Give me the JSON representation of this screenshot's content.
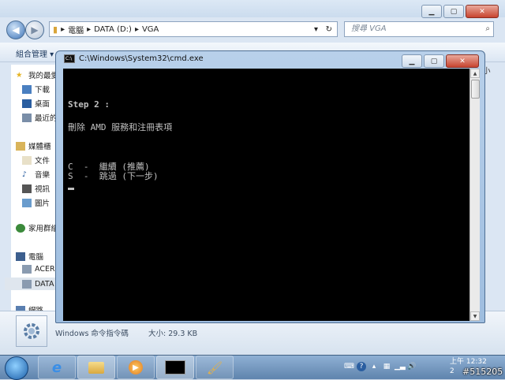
{
  "explorer": {
    "address": {
      "segments": [
        "電腦",
        "DATA (D:)",
        "VGA"
      ]
    },
    "search_placeholder": "搜尋 VGA",
    "organize_label": "組合管理 ▾",
    "sidebar": {
      "items": [
        {
          "label": "我的最愛",
          "icon": "star-icon"
        },
        {
          "label": "下載",
          "icon": "download-folder-icon"
        },
        {
          "label": "桌面",
          "icon": "desktop-icon"
        },
        {
          "label": "最近的",
          "icon": "recent-icon"
        },
        {
          "label": "媒體櫃",
          "icon": "library-icon"
        },
        {
          "label": "文件",
          "icon": "documents-icon"
        },
        {
          "label": "音樂",
          "icon": "music-icon"
        },
        {
          "label": "視訊",
          "icon": "video-icon"
        },
        {
          "label": "圖片",
          "icon": "pictures-icon"
        },
        {
          "label": "家用群組",
          "icon": "homegroup-icon"
        },
        {
          "label": "電腦",
          "icon": "computer-icon"
        },
        {
          "label": "ACER",
          "icon": "drive-icon"
        },
        {
          "label": "DATA",
          "icon": "drive-icon"
        },
        {
          "label": "網路",
          "icon": "network-icon"
        }
      ]
    },
    "right_fragment": "小",
    "details": {
      "type_label": "Windows 命令指令碼",
      "size_label": "大小: 29.3 KB"
    }
  },
  "cmd": {
    "title": "C:\\Windows\\System32\\cmd.exe",
    "icon_text": "C:\\",
    "lines": {
      "step": "Step 2 :",
      "desc": "刪除 AMD 服務和注冊表項",
      "opt_c": "C  -  繼續 (推薦)",
      "opt_s": "S  -  跳過 (下一步)"
    }
  },
  "taskbar": {
    "clock_time": "上午 12:32",
    "clock_date": "2",
    "watermark": "#515205"
  }
}
